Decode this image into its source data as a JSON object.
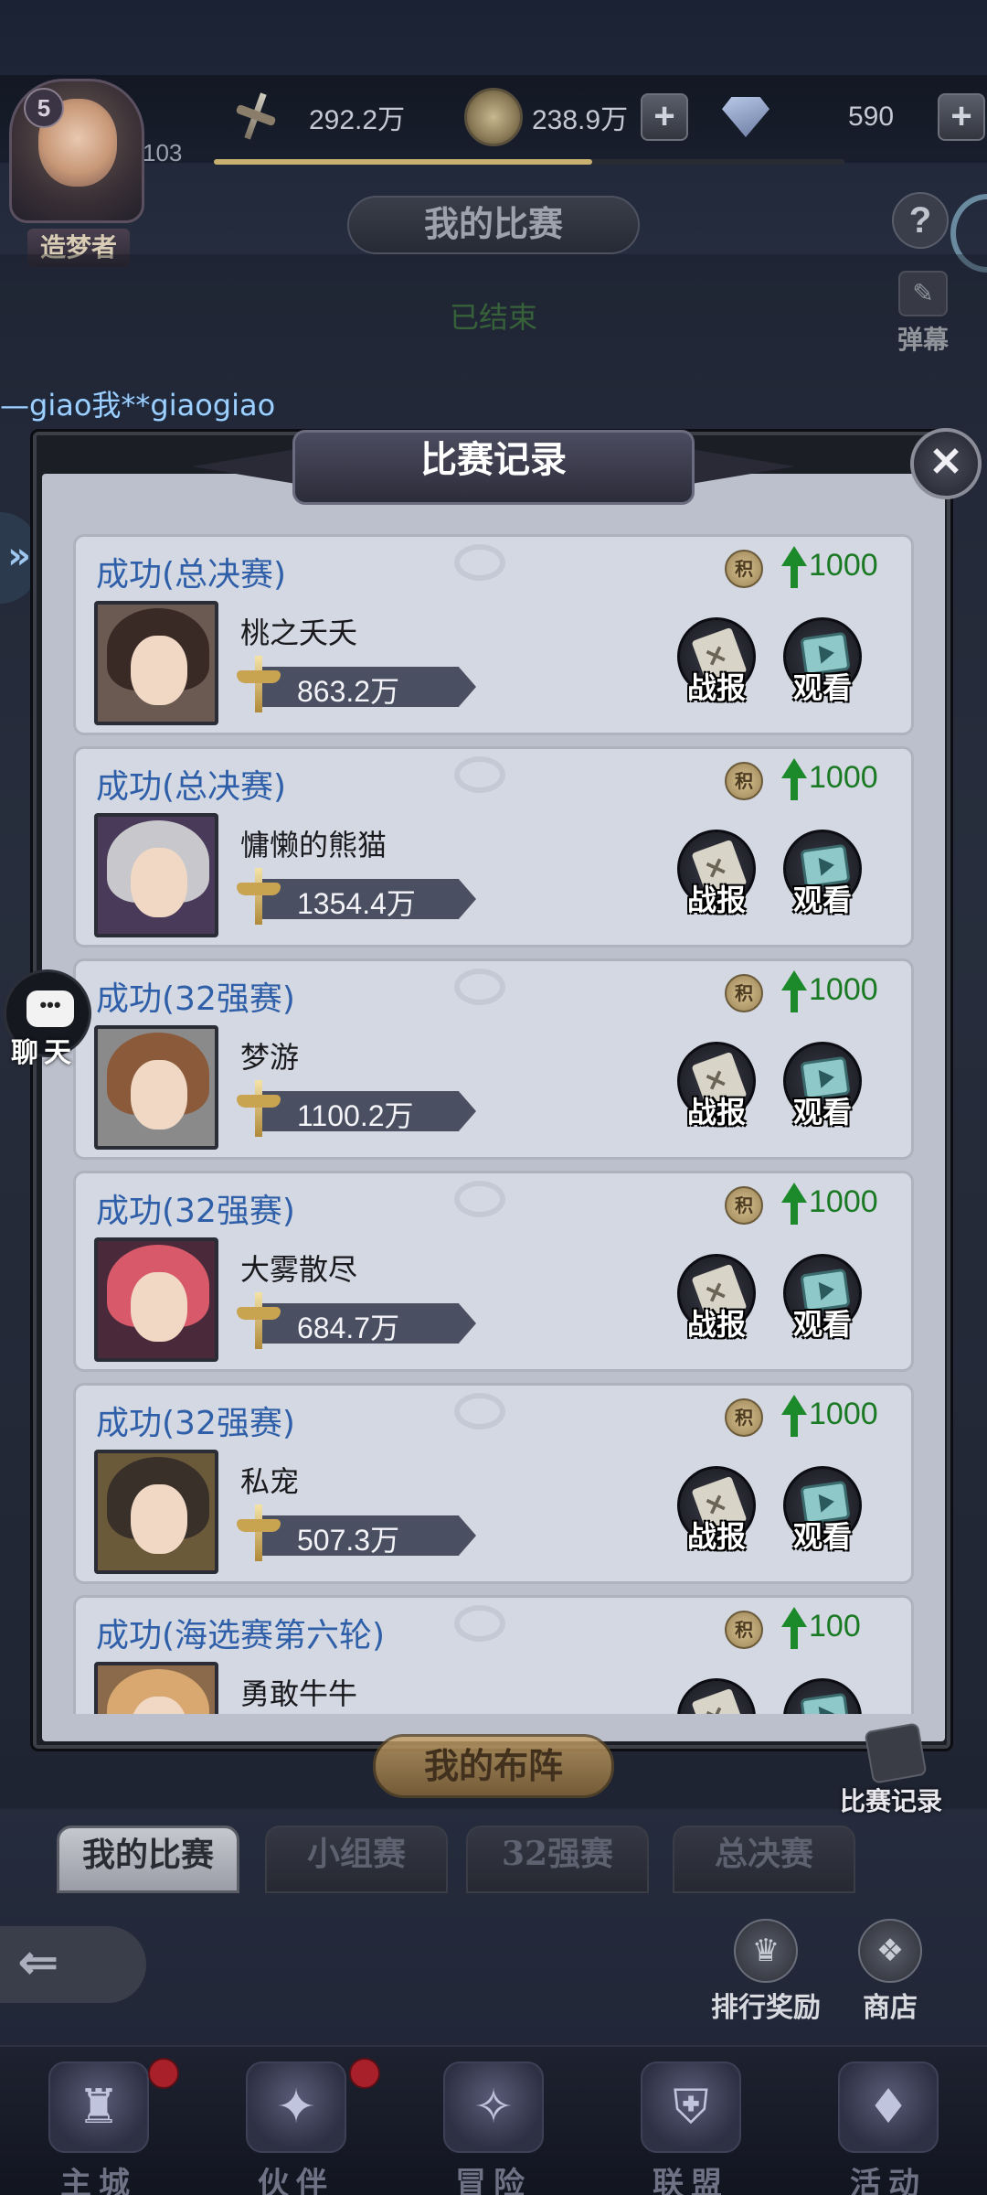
{
  "hud": {
    "level": "5",
    "vip_label": "造梦者",
    "exp_level": "103",
    "power": "292.2万",
    "gold": "238.9万",
    "diamond": "590",
    "plus": "+",
    "help": "?",
    "danmu_label": "弹幕"
  },
  "page": {
    "title": "我的比赛",
    "status": "已结束",
    "danmu_message": "—giao我**giaogiao"
  },
  "modal": {
    "title": "比赛记录",
    "close": "✕",
    "expand": "»",
    "records": [
      {
        "result": "成功(总决赛)",
        "points": "1000",
        "name": "桃之夭夭",
        "power": "863.2万"
      },
      {
        "result": "成功(总决赛)",
        "points": "1000",
        "name": "慵懒的熊猫",
        "power": "1354.4万"
      },
      {
        "result": "成功(32强赛)",
        "points": "1000",
        "name": "梦游",
        "power": "1100.2万"
      },
      {
        "result": "成功(32强赛)",
        "points": "1000",
        "name": "大雾散尽",
        "power": "684.7万"
      },
      {
        "result": "成功(32强赛)",
        "points": "1000",
        "name": "私宠",
        "power": "507.3万"
      },
      {
        "result": "成功(海选赛第六轮)",
        "points": "100",
        "name": "勇敢牛牛",
        "power": ""
      }
    ],
    "coin_glyph": "积",
    "report_label": "战报",
    "watch_label": "观看"
  },
  "chat": {
    "label": "聊天",
    "dots": "•••"
  },
  "lower": {
    "formation": "我的布阵",
    "record_button": "比赛记录",
    "subtabs": [
      "我的比赛",
      "小组赛",
      "32强赛",
      "总决赛"
    ],
    "back_glyph": "⇐",
    "ranking_reward": "排行奖励",
    "shop": "商店"
  },
  "nav": {
    "items": [
      {
        "label": "主城",
        "icon": "castle-icon",
        "glyph": "♜"
      },
      {
        "label": "伙伴",
        "icon": "wizard-hat-icon",
        "glyph": "✦"
      },
      {
        "label": "冒险",
        "icon": "compass-icon",
        "glyph": "✧"
      },
      {
        "label": "联盟",
        "icon": "shield-icon",
        "glyph": "⛨"
      },
      {
        "label": "活动",
        "icon": "cards-icon",
        "glyph": "♦"
      }
    ]
  },
  "colors": {
    "result_blue": "#2e5fa8",
    "points_green": "#1a7a24",
    "status_green": "#4a8a48",
    "badge_red": "#a8202a"
  }
}
